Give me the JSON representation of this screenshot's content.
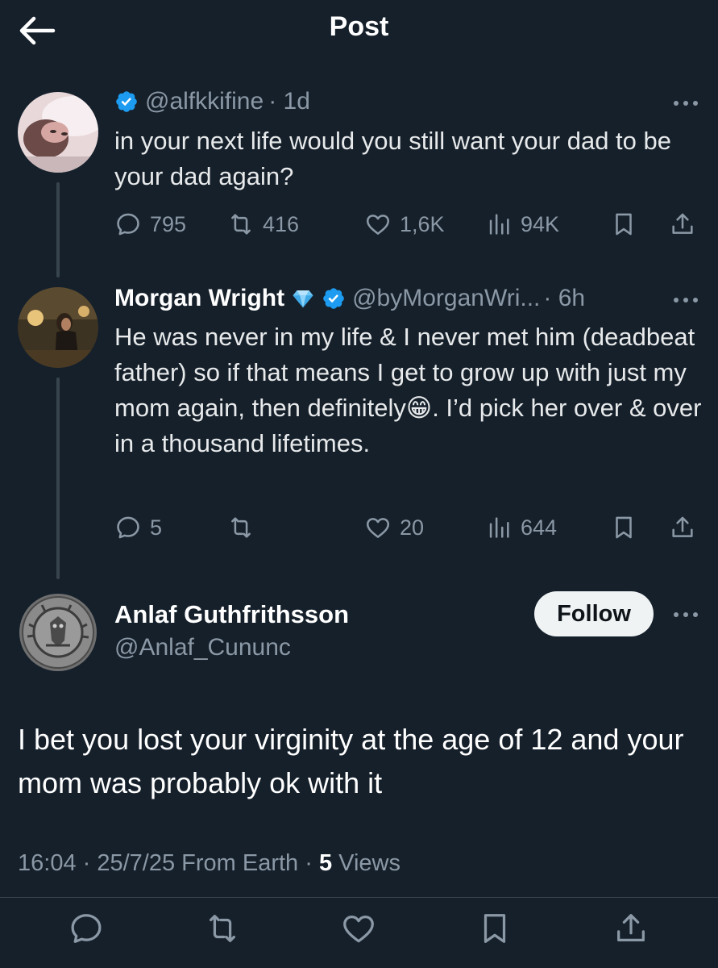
{
  "header": {
    "title": "Post"
  },
  "tweet1": {
    "handle": "@alfkkifine",
    "time": "· 1d",
    "text": "in your next life would you still want your dad to be your dad again?",
    "replies": "795",
    "reposts": "416",
    "likes": "1,6K",
    "views": "94K"
  },
  "tweet2": {
    "name": "Morgan Wright",
    "handle": "@byMorganWri...",
    "time": "· 6h",
    "text_before_emoji": "He was never in my life & I never met him (deadbeat father) so if that means I get to grow up with just my mom again, then definitely",
    "emoji": "😁",
    "text_after_emoji": ". I’d pick her over & over in a thousand lifetimes.",
    "replies": "5",
    "reposts": "",
    "likes": "20",
    "views": "644"
  },
  "main": {
    "name": "Anlaf Guthfrithsson",
    "handle": "@Anlaf_Cununc",
    "follow_label": "Follow",
    "text": "I bet you lost your virginity at the age of 12 and your mom was probably ok with it",
    "time": "16:04 · 25/7/25 From Earth · ",
    "views_count": "5",
    "views_label": " Views"
  },
  "icons": {
    "back": "arrow-left-icon",
    "verified": "verified-badge-icon",
    "diamond": "diamond-emoji-icon",
    "reply": "reply-icon",
    "repost": "repost-icon",
    "like": "heart-icon",
    "views": "views-icon",
    "bookmark": "bookmark-icon",
    "share": "share-icon",
    "more": "more-icon"
  },
  "colors": {
    "background": "#15202b",
    "muted": "#8b98a5",
    "verified": "#1d9bf0",
    "follow_bg": "#eff3f4"
  }
}
